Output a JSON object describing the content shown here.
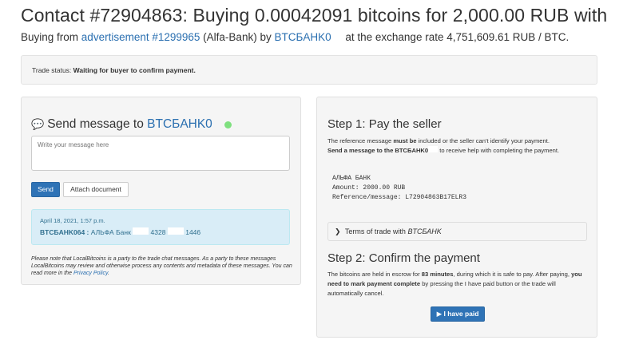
{
  "header": {
    "title": "Contact #72904863: Buying 0.00042091 bitcoins for 2,000.00 RUB with",
    "subtitle_prefix": "Buying from",
    "advertisement_link": "advertisement #1299965",
    "bank_text": "(Alfa-Bank) by",
    "seller_link": "BTCБAHK0",
    "rate_text": "at the exchange rate 4,751,609.61 RUB / BTC."
  },
  "status": {
    "label": "Trade status:",
    "value": "Waiting for buyer to confirm payment."
  },
  "chat": {
    "title_prefix": "Send message to",
    "seller": "BTCБAHK0",
    "input_placeholder": "Write your message here",
    "send_label": "Send",
    "attach_label": "Attach document",
    "message": {
      "date": "April 18, 2021, 1:57 p.m.",
      "sender": "BTCБAHK064 :",
      "text_part1": "АЛЬФА Банк",
      "text_part2": "4328",
      "text_part3": "1446"
    },
    "note_prefix": "Please note that LocalBitcoins is a party to the trade chat messages. As a party to these messages LocalBitcoins may review and otherwise process any contents and metadata of these messages. You can read more in the",
    "privacy_link": "Privacy Policy",
    "note_suffix": "."
  },
  "step1": {
    "title": "Step 1: Pay the seller",
    "text_a": "The reference message",
    "text_b": "must be",
    "text_c": "included or the seller can't identify your payment.",
    "text_d": "Send a message to the BTCБAHK0",
    "text_e": "to receive help with completing the payment.",
    "code_line1": "АЛЬФА БАНК",
    "code_line2": "Amount: 2000.00 RUB",
    "code_line3": "Reference/message: L72904863B17ELR3",
    "terms_prefix": "Terms of trade with",
    "terms_seller": "BTCБAHK"
  },
  "step2": {
    "title": "Step 2: Confirm the payment",
    "text_a": "The bitcoins are held in escrow for",
    "text_b": "83 minutes",
    "text_c": ", during which it is safe to pay. After paying,",
    "text_d": "you need to mark payment complete",
    "text_e": "by pressing the I have paid button or the trade will automatically cancel.",
    "paid_label": "I have paid"
  },
  "colors": {
    "link": "#2a6fb0",
    "primary_button": "#2f73b6",
    "info_bg": "#d9edf7",
    "online": "#7fe07f"
  },
  "icons": {
    "chat": "comment-icon",
    "chevron": "chevron-right-icon",
    "play": "play-icon"
  }
}
